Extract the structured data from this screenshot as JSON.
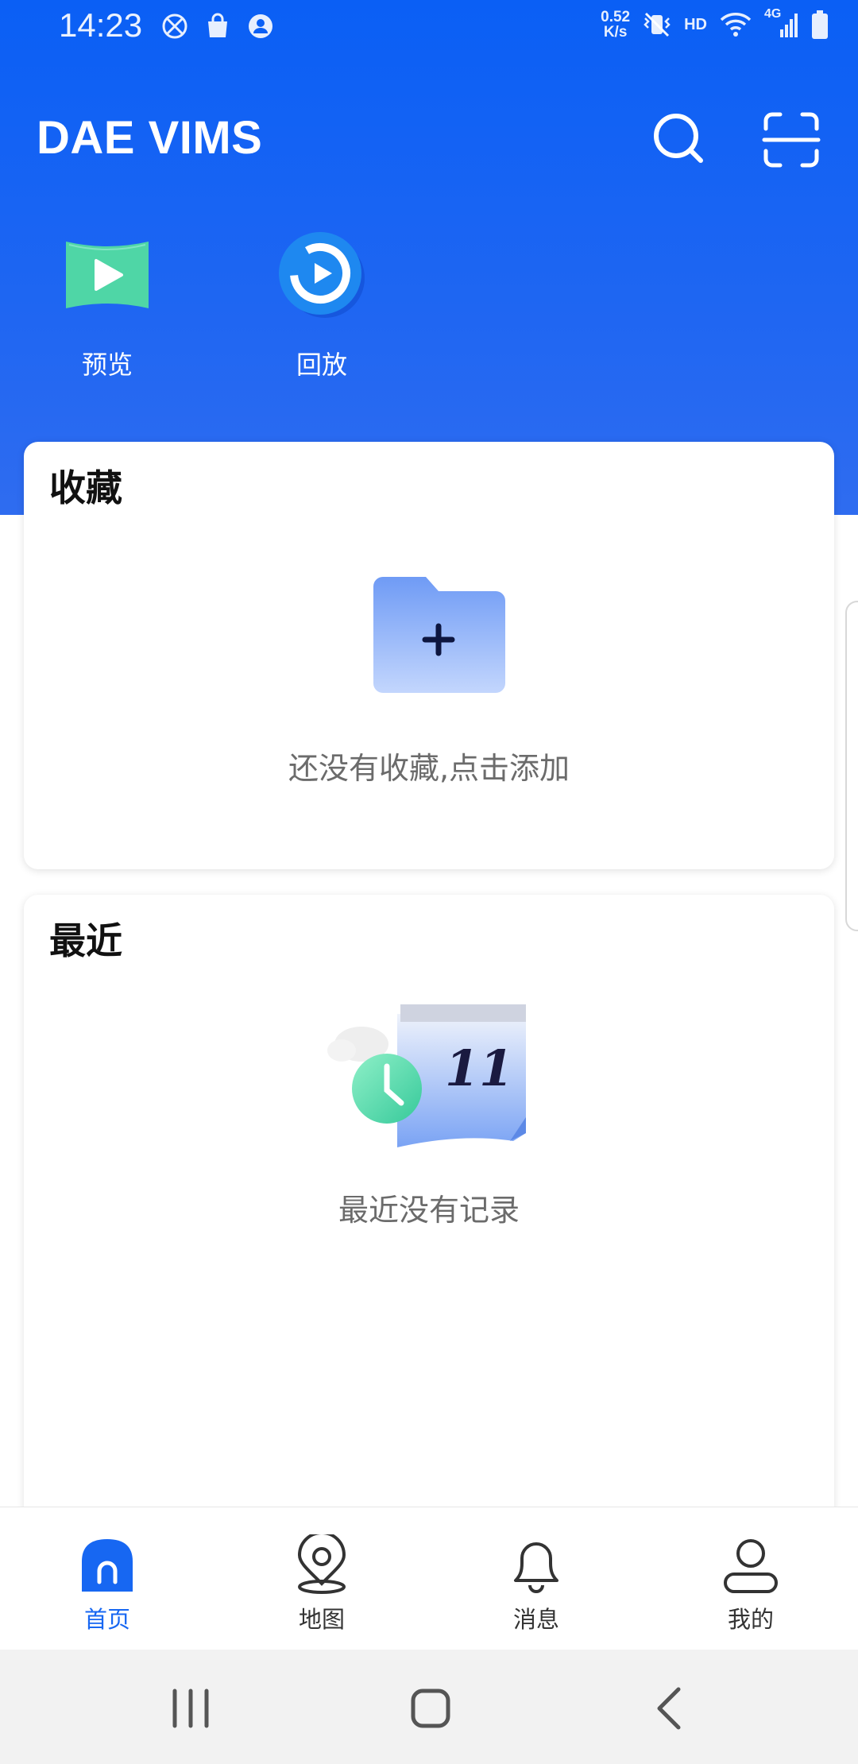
{
  "status_bar": {
    "time": "14:23",
    "net_speed_value": "0.52",
    "net_speed_unit": "K/s",
    "hd": "HD",
    "network": "4G"
  },
  "app_bar": {
    "title": "DAE VIMS",
    "search_icon": "search-icon",
    "scan_icon": "scan-icon"
  },
  "quick_actions": [
    {
      "label": "预览",
      "icon": "play-preview-icon"
    },
    {
      "label": "回放",
      "icon": "playback-icon"
    }
  ],
  "favorites": {
    "title": "收藏",
    "empty_text": "还没有收藏,点击添加",
    "icon": "add-folder-icon"
  },
  "recent": {
    "title": "最近",
    "empty_text": "最近没有记录",
    "icon": "calendar-clock-icon"
  },
  "bottom_nav": [
    {
      "label": "首页",
      "icon": "home-icon",
      "active": true
    },
    {
      "label": "地图",
      "icon": "map-pin-icon",
      "active": false
    },
    {
      "label": "消息",
      "icon": "bell-icon",
      "active": false
    },
    {
      "label": "我的",
      "icon": "user-icon",
      "active": false
    }
  ],
  "colors": {
    "brand_blue": "#0a5ff5",
    "active_tab": "#1767f2",
    "preview_green": "#4fd6a6",
    "folder_blue": "#7ea6f7"
  }
}
